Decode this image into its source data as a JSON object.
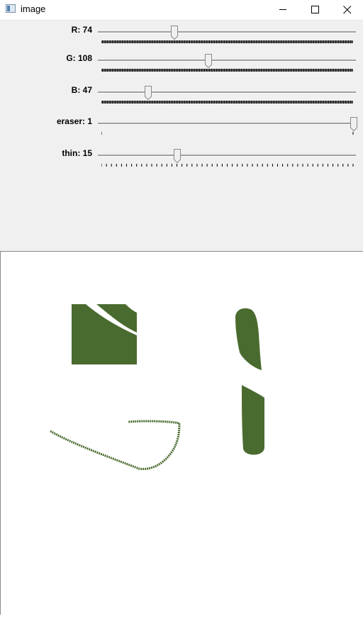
{
  "window": {
    "title": "image",
    "icon": "app-window-icon"
  },
  "controls": [
    {
      "label": "R: 74",
      "value": 74,
      "max": 255,
      "tick_mode": "dense"
    },
    {
      "label": "G: 108",
      "value": 108,
      "max": 255,
      "tick_mode": "dense"
    },
    {
      "label": "B: 47",
      "value": 47,
      "max": 255,
      "tick_mode": "dense"
    },
    {
      "label": "eraser: 1",
      "value": 1,
      "max": 1,
      "tick_mode": "ends"
    },
    {
      "label": "thin: 15",
      "value": 15,
      "max": 50,
      "tick_mode": "sparse"
    }
  ],
  "canvas": {
    "paint_color": "#4a6b2f",
    "background": "#ffffff"
  }
}
